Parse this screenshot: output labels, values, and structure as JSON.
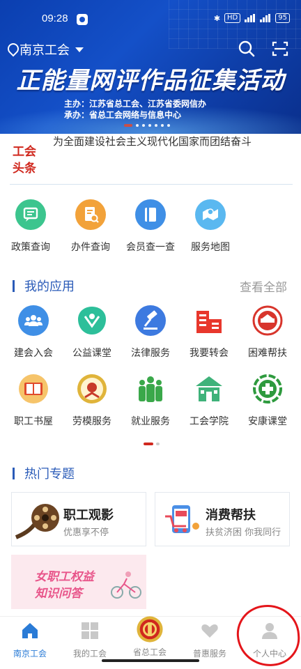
{
  "status_bar": {
    "time": "09:28",
    "network_badge": "HD",
    "battery": "95"
  },
  "header": {
    "location": "南京工会",
    "search_icon": "search-icon",
    "scan_icon": "scan-icon"
  },
  "banner": {
    "title": "正能量网评作品征集活动",
    "line1": "主办：江苏省总工会、江苏省委网信办",
    "line2": "承办：省总工会网络与信息中心",
    "dot_count": 7,
    "active_dot": 0
  },
  "news": {
    "logo_line1": "工会",
    "logo_line2": "头条",
    "text": "为全面建设社会主义现代化国家而团结奋斗"
  },
  "quick_links": [
    {
      "label": "政策查询",
      "icon": "chat-icon",
      "color": "#3cc58e"
    },
    {
      "label": "办件查询",
      "icon": "document-search-icon",
      "color": "#f2a23a"
    },
    {
      "label": "会员查一查",
      "icon": "book-icon",
      "color": "#3f8fe6"
    },
    {
      "label": "服务地图",
      "icon": "map-icon",
      "color": "#5ab8f0"
    }
  ],
  "my_apps": {
    "title": "我的应用",
    "see_all": "查看全部",
    "items": [
      {
        "label": "建会入会",
        "icon": "group-icon",
        "color": "#3f8fe6"
      },
      {
        "label": "公益课堂",
        "icon": "charity-icon",
        "color": "#2dbf9a"
      },
      {
        "label": "法律服务",
        "icon": "gavel-icon",
        "color": "#3d7ae0"
      },
      {
        "label": "我要转会",
        "icon": "building-icon",
        "color": "#e8372c"
      },
      {
        "label": "困难帮扶",
        "icon": "help-emblem-icon",
        "color": "#d8352c"
      },
      {
        "label": "职工书屋",
        "icon": "book-house-icon",
        "color": "#f2a23a"
      },
      {
        "label": "劳模服务",
        "icon": "medal-icon",
        "color": "#e0b43a"
      },
      {
        "label": "就业服务",
        "icon": "people-icon",
        "color": "#3aa84a"
      },
      {
        "label": "工会学院",
        "icon": "school-icon",
        "color": "#3fb27a"
      },
      {
        "label": "安康课堂",
        "icon": "health-cross-icon",
        "color": "#2e9a3e"
      }
    ],
    "page_count": 2,
    "active_page": 0
  },
  "hot_topics": {
    "title": "热门专题",
    "cards": [
      {
        "title": "职工观影",
        "subtitle": "优惠享不停",
        "icon": "film-reel-icon"
      },
      {
        "title": "消费帮扶",
        "subtitle": "扶贫济困 你我同行",
        "icon": "shopping-icon"
      }
    ],
    "promo_line1": "女职工权益",
    "promo_line2": "知识问答"
  },
  "tabbar": {
    "items": [
      {
        "label": "南京工会",
        "icon": "home-icon",
        "active": true
      },
      {
        "label": "我的工会",
        "icon": "grid-icon",
        "active": false
      },
      {
        "label": "省总工会",
        "icon": "union-emblem-icon",
        "active": false
      },
      {
        "label": "普惠服务",
        "icon": "heart-hands-icon",
        "active": false
      },
      {
        "label": "个人中心",
        "icon": "person-icon",
        "active": false
      }
    ]
  },
  "colors": {
    "brand_blue": "#1450c8",
    "section_blue": "#2a5bb8",
    "accent_red": "#d0281e",
    "annotation_red": "#e4151a"
  }
}
